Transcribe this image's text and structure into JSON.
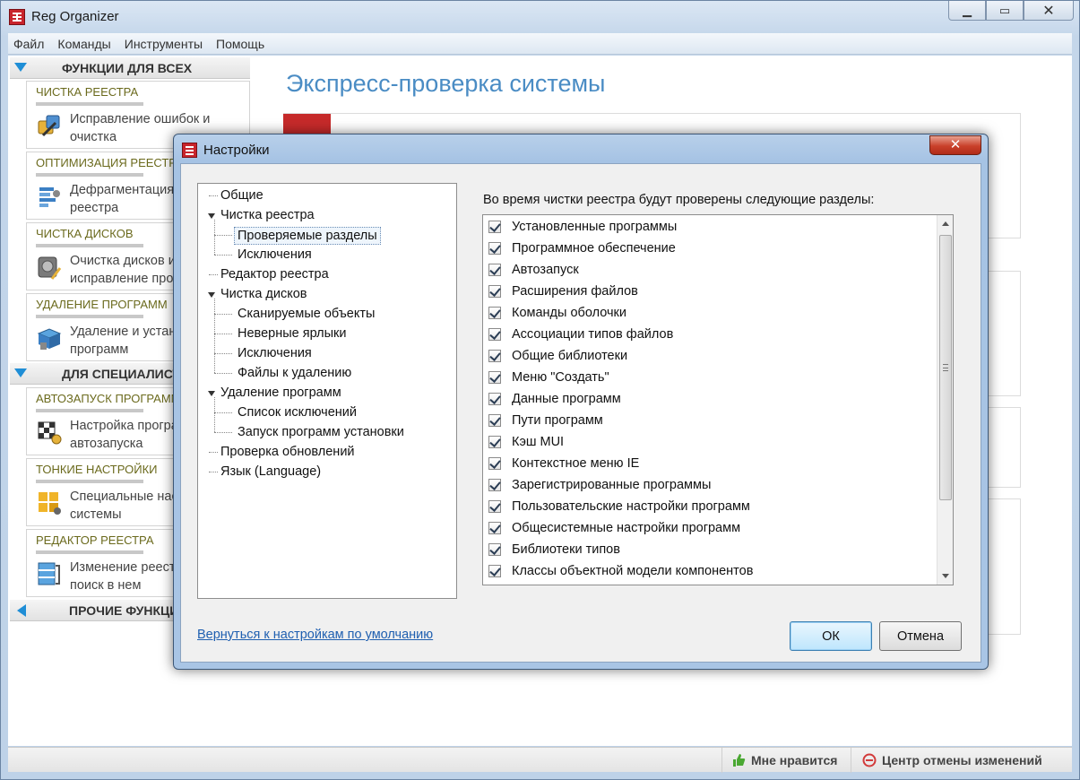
{
  "window": {
    "title": "Reg Organizer",
    "minimize_glyph": "▁",
    "maximize_glyph": "▭",
    "close_glyph": "✕"
  },
  "menu": [
    "Файл",
    "Команды",
    "Инструменты",
    "Помощь"
  ],
  "sidebar": {
    "sections": [
      {
        "label": "Функции для всех"
      },
      {
        "label": "Для специалистов"
      },
      {
        "label": "Прочие функции"
      }
    ],
    "features": [
      {
        "title": "Чистка реестра",
        "desc1": "Исправление ошибок и",
        "desc2": "очистка",
        "icon": "registry-cleaner-icon"
      },
      {
        "title": "Оптимизация реестра",
        "desc1": "Дефрагментация",
        "desc2": "реестра",
        "icon": "defrag-icon"
      },
      {
        "title": "Чистка дисков",
        "desc1": "Очистка дисков и",
        "desc2": "исправление проблем",
        "icon": "disk-cleanup-icon"
      },
      {
        "title": "Удаление программ",
        "desc1": "Удаление и установка",
        "desc2": "программ",
        "icon": "uninstall-icon"
      },
      {
        "title": "Автозапуск программ",
        "desc1": "Настройка программ",
        "desc2": "автозапуска",
        "icon": "autorun-icon"
      },
      {
        "title": "Тонкие настройки",
        "desc1": "Специальные настройки",
        "desc2": "системы",
        "icon": "tweaks-icon"
      },
      {
        "title": "Редактор реестра",
        "desc1": "Изменение реестра и",
        "desc2": "поиск в нем",
        "icon": "registry-editor-icon"
      }
    ]
  },
  "main": {
    "title": "Экспресс-проверка системы"
  },
  "statusbar": {
    "like": "Мне нравится",
    "undo": "Центр отмены изменений"
  },
  "dialog": {
    "title": "Настройки",
    "close_glyph": "✕",
    "tree": [
      {
        "label": "Общие",
        "level": 0
      },
      {
        "label": "Чистка реестра",
        "level": 0,
        "expanded": true
      },
      {
        "label": "Проверяемые разделы",
        "level": 1,
        "selected": true
      },
      {
        "label": "Исключения",
        "level": 1
      },
      {
        "label": "Редактор реестра",
        "level": 0
      },
      {
        "label": "Чистка дисков",
        "level": 0,
        "expanded": true
      },
      {
        "label": "Сканируемые объекты",
        "level": 1
      },
      {
        "label": "Неверные ярлыки",
        "level": 1
      },
      {
        "label": "Исключения",
        "level": 1
      },
      {
        "label": "Файлы к удалению",
        "level": 1
      },
      {
        "label": "Удаление программ",
        "level": 0,
        "expanded": true
      },
      {
        "label": "Список исключений",
        "level": 1
      },
      {
        "label": "Запуск программ установки",
        "level": 1
      },
      {
        "label": "Проверка обновлений",
        "level": 0
      },
      {
        "label": "Язык (Language)",
        "level": 0
      }
    ],
    "sections_label": "Во время чистки реестра будут проверены следующие разделы:",
    "sections": [
      "Установленные программы",
      "Программное обеспечение",
      "Автозапуск",
      "Расширения файлов",
      "Команды оболочки",
      "Ассоциации типов файлов",
      "Общие библиотеки",
      "Меню \"Создать\"",
      "Данные программ",
      "Пути программ",
      "Кэш MUI",
      "Контекстное меню IE",
      "Зарегистрированные программы",
      "Пользовательские настройки программ",
      "Общесистемные настройки программ",
      "Библиотеки типов",
      "Классы объектной модели компонентов"
    ],
    "reset_link": "Вернуться к настройкам по умолчанию",
    "ok": "ОК",
    "cancel": "Отмена"
  },
  "colors": {
    "accent": "#1f8ed6",
    "feature_title": "#6b6a1d",
    "page_title": "#4a8cc4",
    "dialog_close": "#c9402a",
    "link": "#1f5fb0"
  }
}
